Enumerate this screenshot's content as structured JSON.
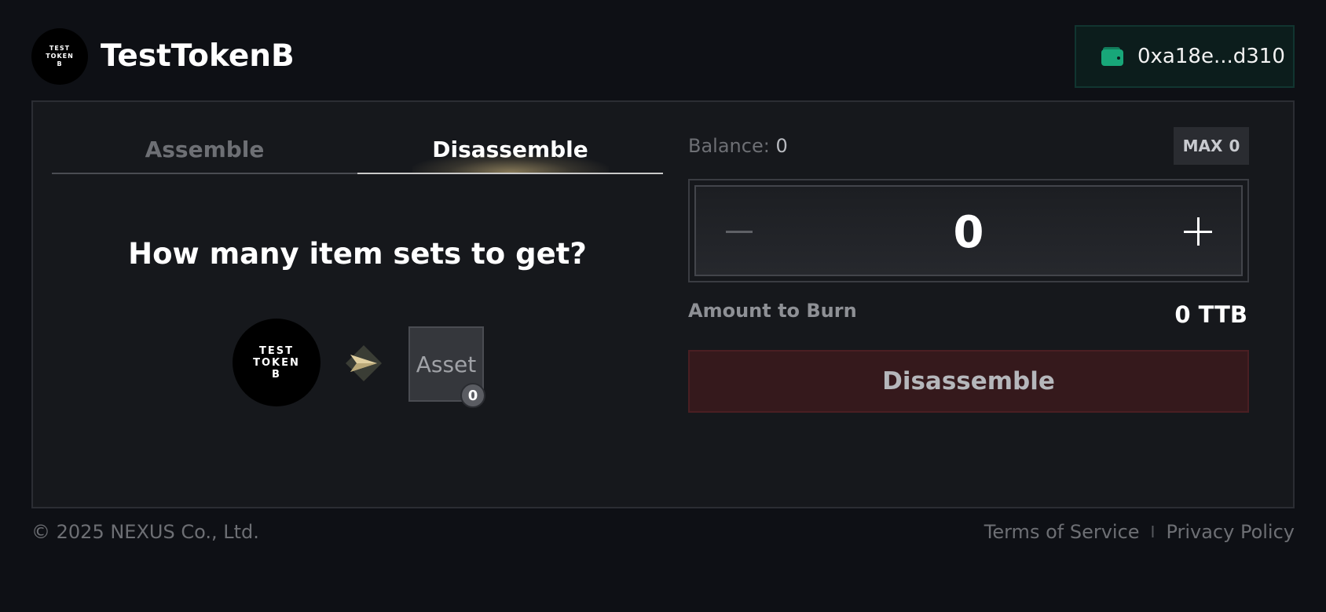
{
  "header": {
    "logo_text": "TEST\nTOKEN\nB",
    "title": "TestTokenB",
    "wallet_address": "0xa18e...d310",
    "wallet_icon": "wallet-icon",
    "wallet_accent": "#18a779"
  },
  "tabs": [
    {
      "label": "Assemble",
      "active": false
    },
    {
      "label": "Disassemble",
      "active": true
    }
  ],
  "main": {
    "question": "How many item sets to get?",
    "token_logo_text": "TEST\nTOKEN\nB",
    "arrow_icon": "arrow-right-icon",
    "asset_label": "Asset",
    "asset_count": "0"
  },
  "panel": {
    "balance_label": "Balance:",
    "balance_value": "0",
    "max_label": "MAX",
    "max_value": "0",
    "quantity": "0",
    "minus_icon": "minus-icon",
    "plus_icon": "plus-icon",
    "burn_label": "Amount to Burn",
    "burn_value": "0 TTB",
    "action_label": "Disassemble",
    "action_color": "#35191c"
  },
  "footer": {
    "copyright": "© 2025 NEXUS Co., Ltd.",
    "terms": "Terms of Service",
    "separator": "I",
    "privacy": "Privacy Policy"
  }
}
